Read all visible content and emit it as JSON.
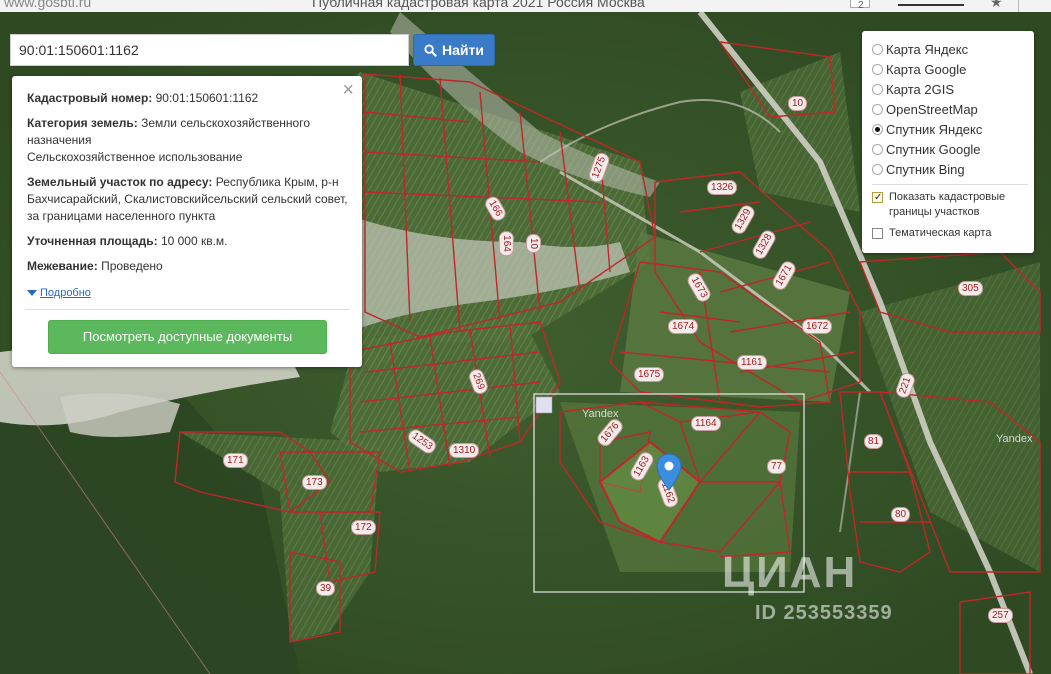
{
  "browser": {
    "url": "www.gosbti.ru",
    "title": "Публичная кадастровая карта 2021 Россия Москва",
    "tab_count": "2"
  },
  "search": {
    "value": "90:01:150601:1162",
    "button_label": "Найти"
  },
  "info": {
    "cad_number_label": "Кадастровый номер:",
    "cad_number": "90:01:150601:1162",
    "category_label": "Категория земель:",
    "category_value": "Земли сельскохозяйственного назначения",
    "usage": "Сельскохозяйственное использование",
    "address_label": "Земельный участок по адресу:",
    "address_value": "Республика Крым, р-н Бахчисарайский, Скалистовскийсельский сельский совет, за границами населенного пункта",
    "area_label": "Уточненная площадь:",
    "area_value": "10 000 кв.м.",
    "survey_label": "Межевание:",
    "survey_value": "Проведено",
    "more_link": "Подробно",
    "docs_button": "Посмотреть доступные документы"
  },
  "layers": {
    "options": [
      {
        "label": "Карта Яндекс",
        "selected": false
      },
      {
        "label": "Карта Google",
        "selected": false
      },
      {
        "label": "Карта 2GIS",
        "selected": false
      },
      {
        "label": "OpenStreetMap",
        "selected": false
      },
      {
        "label": "Спутник Яндекс",
        "selected": true
      },
      {
        "label": "Спутник Google",
        "selected": false
      },
      {
        "label": "Спутник Bing",
        "selected": false
      }
    ],
    "show_borders_label": "Показать кадастровые границы участков",
    "show_borders_checked": true,
    "thematic_label": "Тематическая карта",
    "thematic_checked": false
  },
  "parcels": [
    "10",
    "1275",
    "166",
    "164",
    "10",
    "1326",
    "1329",
    "1328",
    "1671",
    "1673",
    "1674",
    "305",
    "1672",
    "1675",
    "1161",
    "269",
    "221",
    "1253",
    "1310",
    "1676",
    "1164",
    "81",
    "171",
    "173",
    "1163",
    "1162",
    "77",
    "172",
    "80",
    "39",
    "257"
  ],
  "watermarks": {
    "yandex_1": "Yandex",
    "yandex_2": "Yandex",
    "cian": "ЦИАН",
    "cian_id": "ID 253553359"
  },
  "colors": {
    "parcel_border": "#c0262a",
    "search_button": "#3a7bc8",
    "docs_button": "#5cb85c",
    "link": "#2a6ab8"
  }
}
